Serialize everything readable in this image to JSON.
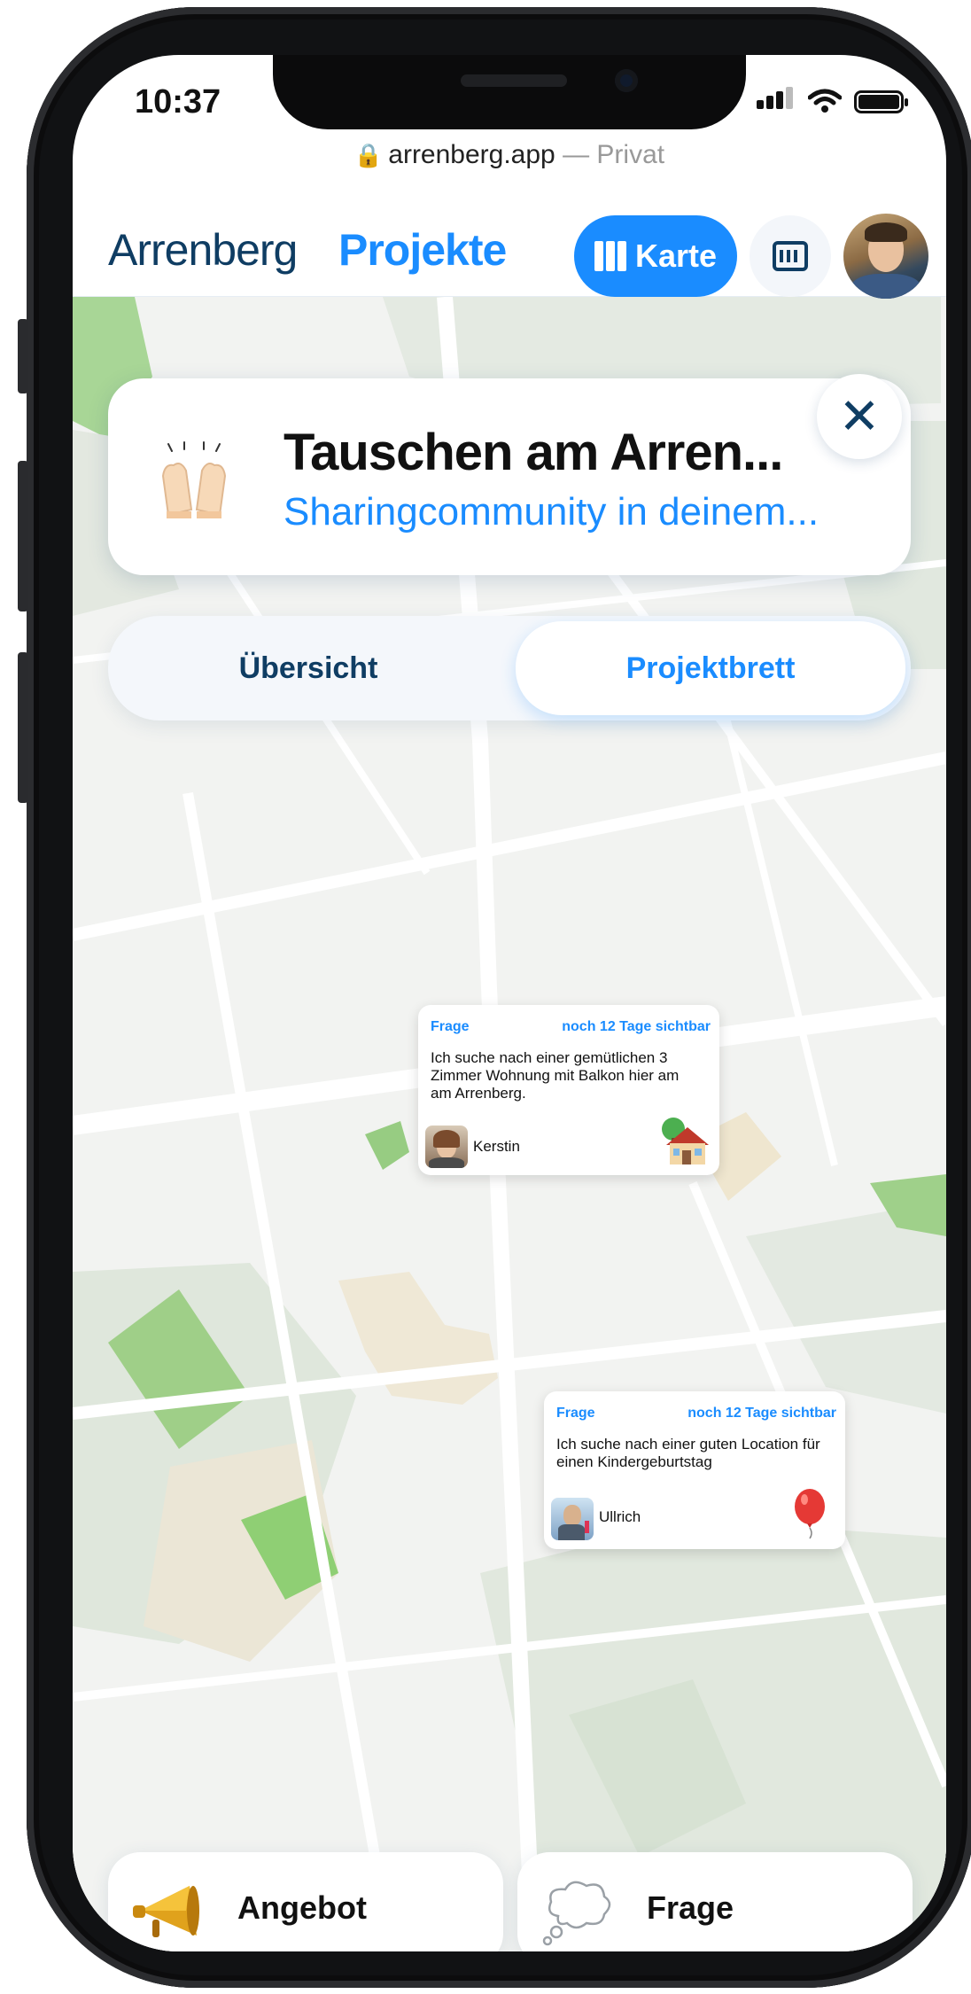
{
  "status_bar": {
    "time": "10:37"
  },
  "browser": {
    "domain": "arrenberg.app",
    "separator": " — ",
    "mode": "Privat"
  },
  "header": {
    "brand": "Arrenberg",
    "nav_projects": "Projekte",
    "map_button_label": "Karte",
    "icons": {
      "map": "map-icon",
      "calendar": "calendar-icon"
    }
  },
  "project": {
    "title": "Tauschen am Arren...",
    "subtitle": "Sharingcommunity in deinem...",
    "icon": "raising-hands-icon"
  },
  "tabs": [
    {
      "label": "Übersicht",
      "active": false
    },
    {
      "label": "Projektbrett",
      "active": true
    }
  ],
  "posts": [
    {
      "type": "Frage",
      "visibility": "noch 12 Tage sichtbar",
      "text_lines": [
        "Ich suche nach einer gemütlichen 3",
        "Zimmer Wohnung mit Balkon hier am",
        "am Arrenberg."
      ],
      "author": "Kerstin",
      "icon": "house-icon"
    },
    {
      "type": "Frage",
      "visibility": "noch 12 Tage sichtbar",
      "text_lines": [
        "Ich suche nach einer guten Location für",
        "einen  Kindergeburtstag"
      ],
      "author": "Ullrich",
      "icon": "balloon-icon"
    }
  ],
  "bottom_actions": [
    {
      "label": "Angebot",
      "icon": "megaphone-icon"
    },
    {
      "label": "Frage",
      "icon": "thought-bubble-icon"
    }
  ],
  "colors": {
    "accent": "#1a8cff",
    "brand_dark": "#0f3d63",
    "map_bg": "#f2f3f1",
    "park": "#9fd08a"
  }
}
